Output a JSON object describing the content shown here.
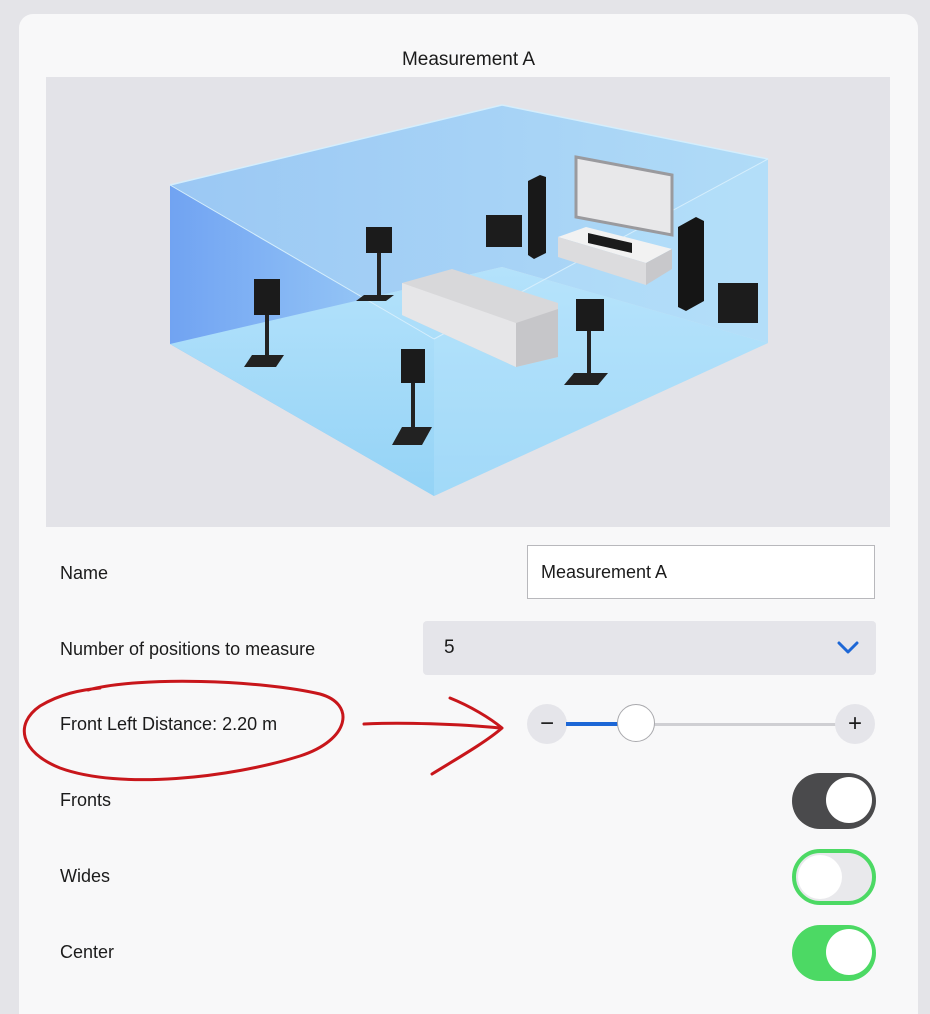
{
  "window": {
    "title": "Measurement A"
  },
  "room_illustration": {
    "description_icon": "home-theater-room-icon"
  },
  "form": {
    "name_label": "Name",
    "name_value": "Measurement A",
    "positions_label": "Number of positions to measure",
    "positions_value": "5",
    "distance_label": "Front Left Distance: 2.20 m",
    "distance_fraction": 0.26,
    "minus_label": "−",
    "plus_label": "+",
    "fronts_label": "Fronts",
    "fronts_state": "on-dark",
    "wides_label": "Wides",
    "wides_state": "off",
    "center_label": "Center",
    "center_state": "on"
  },
  "colors": {
    "accent": "#1d67d6",
    "toggle_on": "#4cd964",
    "toggle_dark": "#4a4a4c",
    "annotation": "#c8161b"
  }
}
